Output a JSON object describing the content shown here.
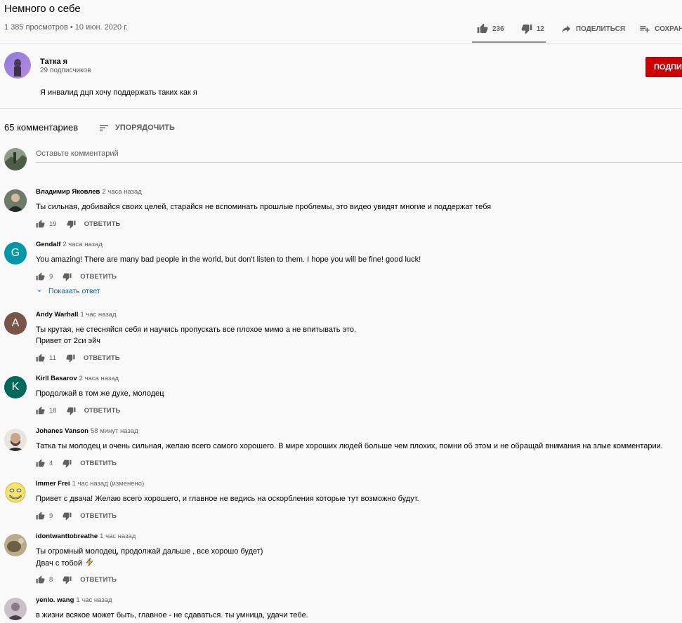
{
  "video": {
    "title": "Немного о себе",
    "meta": "1 385 просмотров • 10 июн. 2020 г.",
    "likes": "236",
    "dislikes": "12",
    "share_label": "ПОДЕЛИТЬСЯ",
    "save_label": "СОХРАНИ"
  },
  "channel": {
    "name": "Татка я",
    "subscribers": "29 подписчиков",
    "subscribe_label": "ПОДПИ",
    "description": "Я инвалид дцп хочу поддержать таких как я"
  },
  "comments_header": {
    "count": "65 комментариев",
    "sort_label": "УПОРЯДОЧИТЬ",
    "add_placeholder": "Оставьте комментарий"
  },
  "comments": [
    {
      "author": "Владимир Яковлев",
      "time": "2 часа назад",
      "lines": [
        "Ты сильная, добивайся своих целей, старайся не вспоминать прошлые проблемы, это видео увидят многие и поддержат тебя"
      ],
      "likes": "19",
      "reply_label": "ОТВЕТИТЬ",
      "avatar_letter": "",
      "avatar_color": "#3c4a3a"
    },
    {
      "author": "Gendalf",
      "time": "2 часа назад",
      "lines": [
        "You amazing! There are many bad people in the world, but don't listen to them. I hope you will be fine! good luck!"
      ],
      "likes": "9",
      "reply_label": "ОТВЕТИТЬ",
      "avatar_letter": "G",
      "avatar_color": "#0097a7",
      "show_replies": "Показать ответ"
    },
    {
      "author": "Andy Warhall",
      "time": "1 час назад",
      "lines": [
        "Ты крутая, не стесняйся себя и научись пропускать все плохое мимо а не впитывать это.",
        "Привет от 2си эйч"
      ],
      "likes": "11",
      "reply_label": "ОТВЕТИТЬ",
      "avatar_letter": "A",
      "avatar_color": "#795548"
    },
    {
      "author": "Kirll Basarov",
      "time": "2 часа назад",
      "lines": [
        "Продолжай в том же духе, молодец"
      ],
      "likes": "18",
      "reply_label": "ОТВЕТИТЬ",
      "avatar_letter": "K",
      "avatar_color": "#00695c"
    },
    {
      "author": "Johanes Vanson",
      "time": "58 минут назад",
      "lines": [
        "Татка ты молодец и очень сильная, желаю всего самого хорошего. В мире хороших людей больше чем плохих, помни об этом и не обращай внимания на злые комментарии."
      ],
      "likes": "4",
      "reply_label": "ОТВЕТИТЬ",
      "avatar_letter": "",
      "avatar_color": "#5d4a3e"
    },
    {
      "author": "Immer Frei",
      "time": "1 час назад (изменено)",
      "lines": [
        "Привет с двача! Желаю всего хорошего, и главное не ведись на оскорбления которые тут возможно будут."
      ],
      "likes": "9",
      "reply_label": "ОТВЕТИТЬ",
      "avatar_letter": "",
      "avatar_color": "#f5e36a"
    },
    {
      "author": "idontwanttobreathe",
      "time": "1 час назад",
      "lines": [
        "Ты огромный молодец, продолжай дальше , все хорошо будет)",
        "Двач с тобой"
      ],
      "likes": "8",
      "reply_label": "ОТВЕТИТЬ",
      "avatar_letter": "",
      "avatar_color": "#8a7a5a"
    },
    {
      "author": "yenlo. wang",
      "time": "1 час назад",
      "lines": [
        "в жизни всякое может быть, главное - не сдаваться. ты умница, удачи тебе."
      ],
      "likes": "",
      "reply_label": "",
      "avatar_letter": "",
      "avatar_color": "#6a5d6e"
    }
  ]
}
